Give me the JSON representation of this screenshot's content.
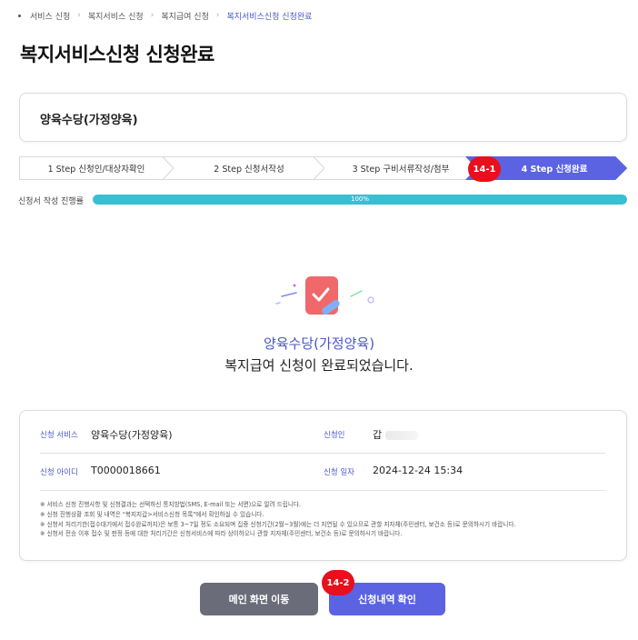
{
  "breadcrumb": {
    "items": [
      "서비스 신청",
      "복지서비스 신청",
      "복지급여 신청",
      "복지서비스신청 신청완료"
    ],
    "separator": "›"
  },
  "page": {
    "title": "복지서비스신청 신청완료"
  },
  "service_box": {
    "name": "양육수당(가정양육)"
  },
  "steps": [
    {
      "label": "1 Step 신청인/대상자확인",
      "active": false
    },
    {
      "label": "2 Step 신청서작성",
      "active": false
    },
    {
      "label": "3 Step 구비서류작성/첨부",
      "active": false
    },
    {
      "label": "4 Step 신청완료",
      "active": true
    }
  ],
  "annotations": {
    "badge_1": "14-1",
    "badge_2": "14-2"
  },
  "progress": {
    "label": "신청서 작성 진행률",
    "value_text": "100%",
    "value": 100
  },
  "completion": {
    "service_name": "양육수당(가정양육)",
    "message": "복지급여 신청이 완료되었습니다."
  },
  "info": {
    "service_label": "신청 서비스",
    "service_value": "양육수당(가정양육)",
    "applicant_label": "신청인",
    "applicant_value": "갑",
    "id_label": "신청 아이디",
    "id_value": "T0000018661",
    "date_label": "신청 일자",
    "date_value": "2024-12-24 15:34"
  },
  "notes": [
    "※ 서비스 신청 진행사항 및 신청결과는 선택하신 통지방법(SMS, E-mail 또는 서면)으로 알려 드립니다.",
    "※ 신청 진행상황 조회 및 내역은 \"복지지갑>서비스신청 목록\"에서 확인하실 수 있습니다.",
    "※ 신청서 처리기한(접수대기에서 접수완료까지)은 보통 3~7일 정도 소요되며 집중 신청기간(2월~3월)에는 더 지연될 수 있으므로 관할 지자체(주민센터, 보건소 등)로 문의하시기 바랍니다.",
    "※ 신청서 전송 이후 접수 및 판정 등에 대한 처리기간은 신청서비스에 따라 상이하오니 관할 지자체(주민센터, 보건소 등)로 문의하시기 바랍니다."
  ],
  "buttons": {
    "main": "메인 화면 이동",
    "history": "신청내역 확인"
  },
  "colors": {
    "accent": "#5b63e2",
    "label_blue": "#4a56c9",
    "progress": "#37c0d2",
    "badge": "#e8101d",
    "button_gray": "#6b6c79"
  }
}
